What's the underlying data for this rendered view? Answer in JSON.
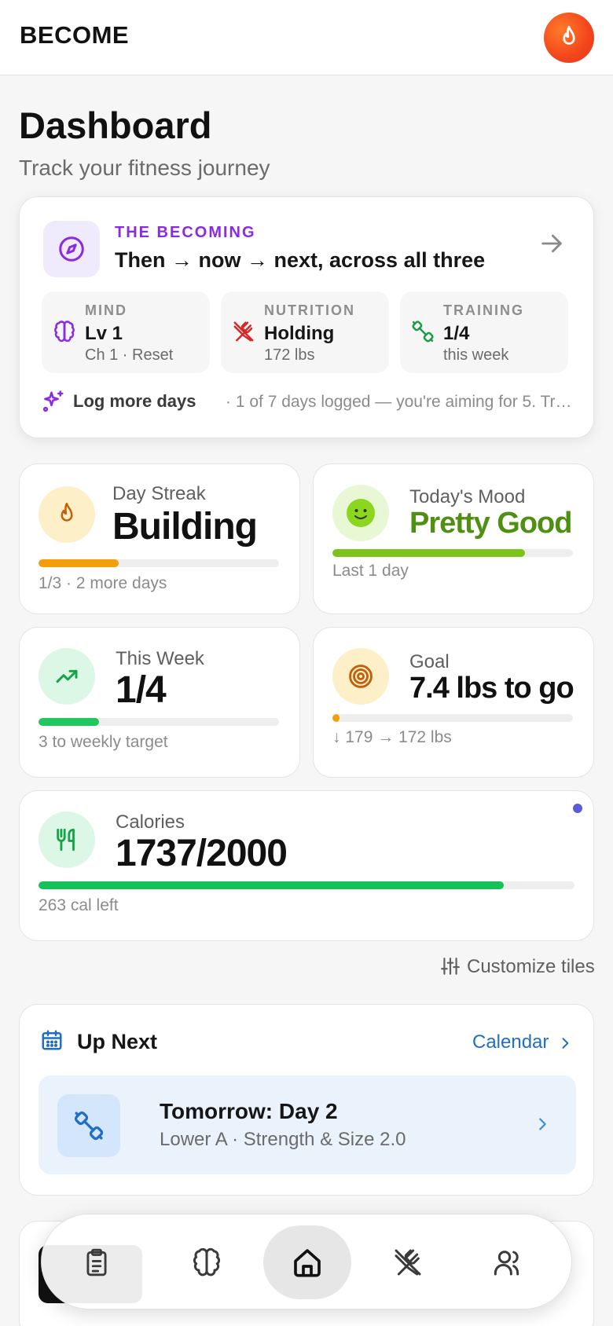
{
  "header": {
    "brand": "BECOME",
    "avatar_icon": "flame-icon"
  },
  "page": {
    "title": "Dashboard",
    "subtitle": "Track your fitness journey"
  },
  "becoming": {
    "kicker": "THE BECOMING",
    "title": "Then → now → next, across all three",
    "pillars": [
      {
        "label": "MIND",
        "value": "Lv 1",
        "sub": "Ch 1 · Reset",
        "icon": "brain-icon",
        "color": "#8a2be2"
      },
      {
        "label": "NUTRITION",
        "value": "Holding",
        "sub": "172 lbs",
        "icon": "utensils-off-icon",
        "color": "#d62828"
      },
      {
        "label": "TRAINING",
        "value": "1/4",
        "sub": "this week",
        "icon": "dumbbell-icon",
        "color": "#1a9c4a"
      }
    ],
    "footer_strong": "Log more days",
    "footer_text": "· 1 of 7 days logged — you're aiming for 5. Tr…"
  },
  "tiles": {
    "streak": {
      "label": "Day Streak",
      "value": "Building",
      "foot": "1/3 · 2 more days",
      "progress": 0.333,
      "color": "#f59e0b",
      "icon": "flame-icon"
    },
    "mood": {
      "label": "Today's Mood",
      "value": "Pretty Good",
      "foot": "Last 1 day",
      "progress": 0.8,
      "color": "#7cc41a",
      "icon": "smiley-face-icon"
    },
    "week": {
      "label": "This Week",
      "value": "1/4",
      "foot": "3 to weekly target",
      "progress": 0.25,
      "color": "#22c55e",
      "icon": "trending-up-icon"
    },
    "goal": {
      "label": "Goal",
      "value": "7.4 lbs to go",
      "foot": "↓ 179 → 172 lbs",
      "progress": 0.03,
      "color": "#f59e0b",
      "icon": "target-icon"
    },
    "calories": {
      "label": "Calories",
      "value": "1737/2000",
      "foot": "263 cal left",
      "progress": 0.8685,
      "color": "#16c15a",
      "icon": "utensils-icon"
    }
  },
  "customize": {
    "label": "Customize tiles",
    "icon": "sliders-icon"
  },
  "upnext": {
    "title": "Up Next",
    "link": "Calendar",
    "item": {
      "title": "Tomorrow: Day 2",
      "sub": "Lower A · Strength & Size 2.0",
      "icon": "dumbbell-icon"
    }
  },
  "nav": {
    "items": [
      {
        "name": "clipboard-icon",
        "active": false
      },
      {
        "name": "brain-icon",
        "active": false
      },
      {
        "name": "home-icon",
        "active": true
      },
      {
        "name": "utensils-off-icon",
        "active": false
      },
      {
        "name": "users-icon",
        "active": false
      }
    ]
  }
}
